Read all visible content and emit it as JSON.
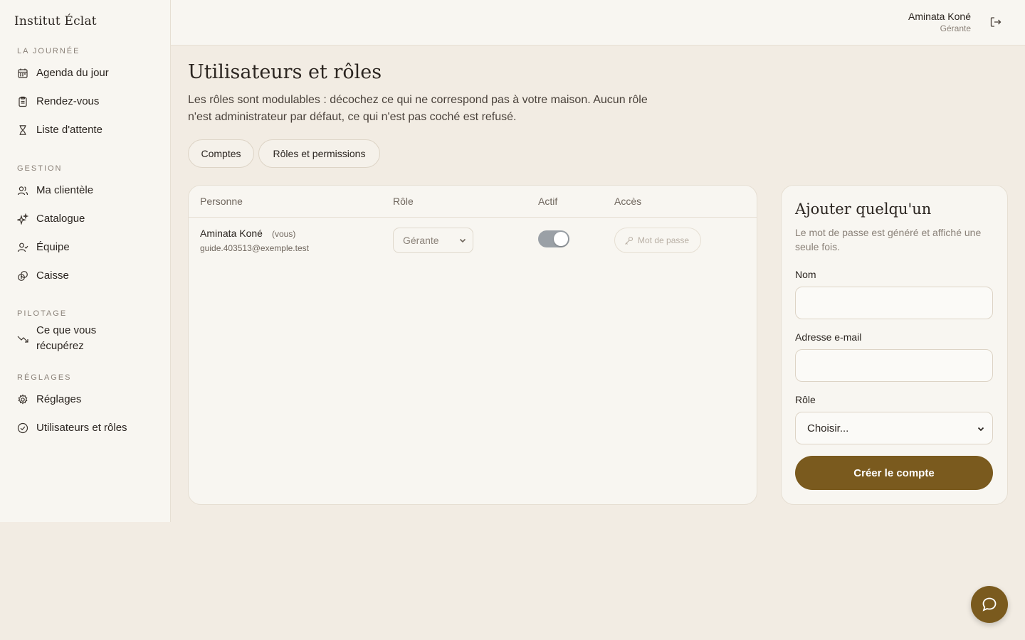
{
  "brand": "Institut Éclat",
  "sidebar": {
    "sections": [
      {
        "title": "LA JOURNÉE"
      },
      {
        "title": "GESTION"
      },
      {
        "title": "PILOTAGE"
      },
      {
        "title": "RÉGLAGES"
      }
    ],
    "items": [
      {
        "label": "Agenda du jour",
        "icon": "calendar-icon"
      },
      {
        "label": "Rendez-vous",
        "icon": "clipboard-icon"
      },
      {
        "label": "Liste d'attente",
        "icon": "hourglass-icon"
      },
      {
        "label": "Ma clientèle",
        "icon": "users-icon"
      },
      {
        "label": "Catalogue",
        "icon": "sparkles-icon"
      },
      {
        "label": "Équipe",
        "icon": "team-icon"
      },
      {
        "label": "Caisse",
        "icon": "coins-icon"
      },
      {
        "label": "Ce que vous récupérez",
        "icon": "trending-down-icon"
      },
      {
        "label": "Réglages",
        "icon": "gear-icon"
      },
      {
        "label": "Utilisateurs et rôles",
        "icon": "check-circle-icon"
      }
    ]
  },
  "header": {
    "user_name": "Aminata Koné",
    "user_role": "Gérante",
    "logout_icon": "logout-icon"
  },
  "main": {
    "title": "Utilisateurs et rôles",
    "description": "Les rôles sont modulables : décochez ce qui ne correspond pas à votre maison. Aucun rôle n'est administrateur par défaut, ce qui n'est pas coché est refusé.",
    "tabs": [
      {
        "label": "Comptes"
      },
      {
        "label": "Rôles et permissions"
      }
    ],
    "table": {
      "columns": [
        "Personne",
        "Rôle",
        "Actif",
        "Accès"
      ],
      "rows": [
        {
          "name": "Aminata Koné",
          "tag": "(vous)",
          "email": "guide.403513@exemple.test",
          "role": "Gérante",
          "active": true,
          "access_label": "Mot de passe"
        }
      ]
    }
  },
  "add_panel": {
    "title": "Ajouter quelqu'un",
    "description": "Le mot de passe est généré et affiché une seule fois.",
    "name_label": "Nom",
    "name_value": "",
    "email_label": "Adresse e-mail",
    "email_value": "",
    "role_label": "Rôle",
    "role_value": "Choisir...",
    "submit_label": "Créer le compte"
  },
  "colors": {
    "accent": "#7a5a1e",
    "background": "#f2ece3",
    "panel": "#f8f6f1"
  }
}
